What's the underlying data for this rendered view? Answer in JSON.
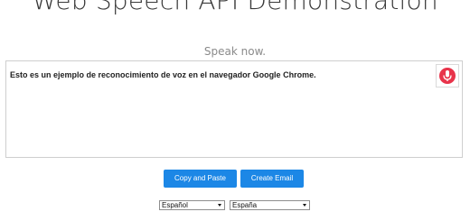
{
  "header": {
    "title": "Web Speech API Demonstration"
  },
  "status": {
    "text": "Speak now."
  },
  "transcript": {
    "text": "Esto es un ejemplo de reconocimiento de voz en el navegador Google Chrome."
  },
  "mic": {
    "icon": "microphone-icon",
    "accent_color": "#e8334a"
  },
  "buttons": {
    "copy_label": "Copy and Paste",
    "email_label": "Create Email",
    "color": "#1c87e6"
  },
  "selects": {
    "language": "Español",
    "dialect": "España"
  }
}
